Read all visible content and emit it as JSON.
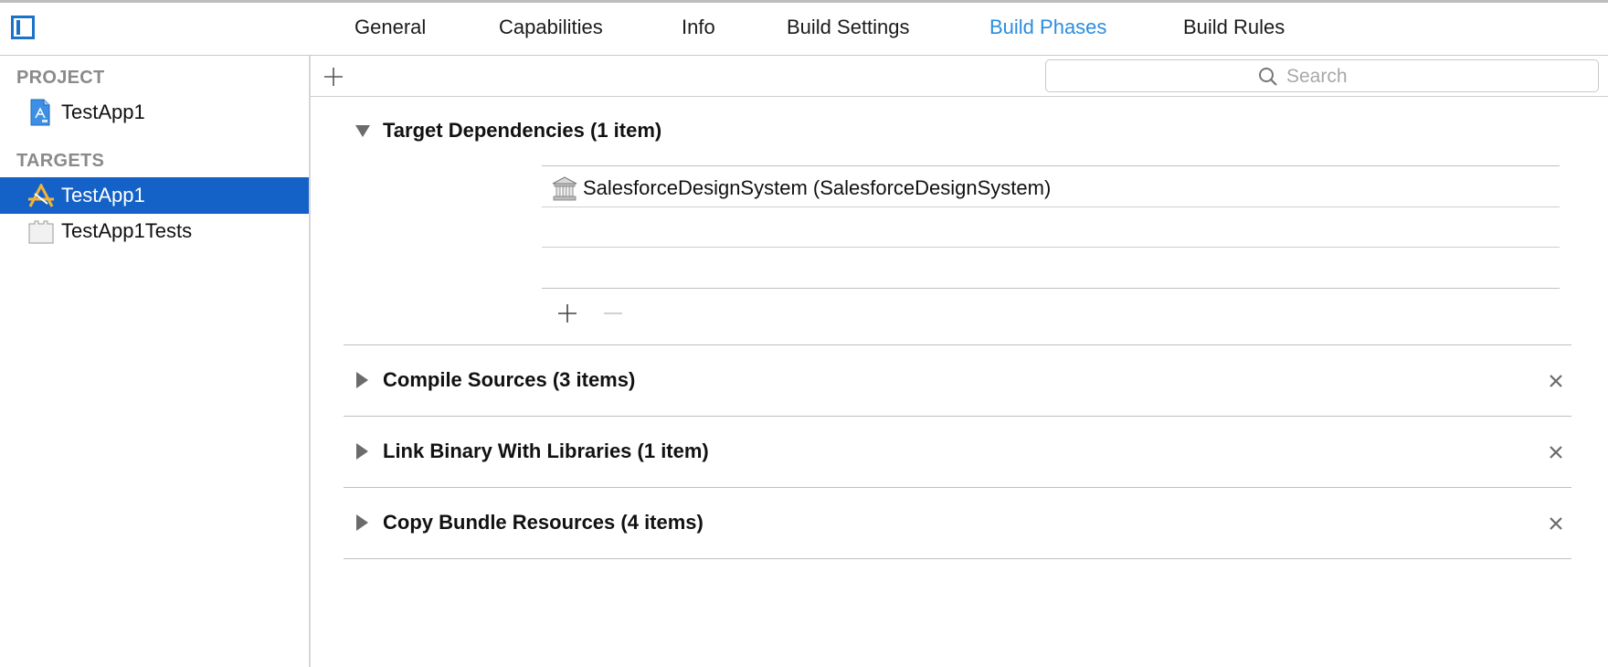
{
  "tabs": [
    {
      "label": "General",
      "active": false
    },
    {
      "label": "Capabilities",
      "active": false
    },
    {
      "label": "Info",
      "active": false
    },
    {
      "label": "Build Settings",
      "active": false
    },
    {
      "label": "Build Phases",
      "active": true
    },
    {
      "label": "Build Rules",
      "active": false
    }
  ],
  "sidebar": {
    "project_header": "PROJECT",
    "project": {
      "label": "TestApp1",
      "icon": "xcodeproj-file-icon"
    },
    "targets_header": "TARGETS",
    "targets": [
      {
        "label": "TestApp1",
        "icon": "app-target-icon",
        "selected": true
      },
      {
        "label": "TestApp1Tests",
        "icon": "test-bundle-icon",
        "selected": false
      }
    ]
  },
  "toolbar": {
    "add_icon": "plus-icon",
    "search_placeholder": "Search",
    "search_icon": "magnifier-icon"
  },
  "phases": [
    {
      "title": "Target Dependencies (1 item)",
      "expanded": true,
      "removable": false,
      "items": [
        {
          "label": "SalesforceDesignSystem (SalesforceDesignSystem)",
          "icon": "framework-icon"
        }
      ]
    },
    {
      "title": "Compile Sources (3 items)",
      "expanded": false,
      "removable": true
    },
    {
      "title": "Link Binary With Libraries (1 item)",
      "expanded": false,
      "removable": true
    },
    {
      "title": "Copy Bundle Resources (4 items)",
      "expanded": false,
      "removable": true
    }
  ],
  "colors": {
    "accent": "#2b8de0",
    "selection": "#1462c7",
    "section_header": "#8a8a8a"
  }
}
